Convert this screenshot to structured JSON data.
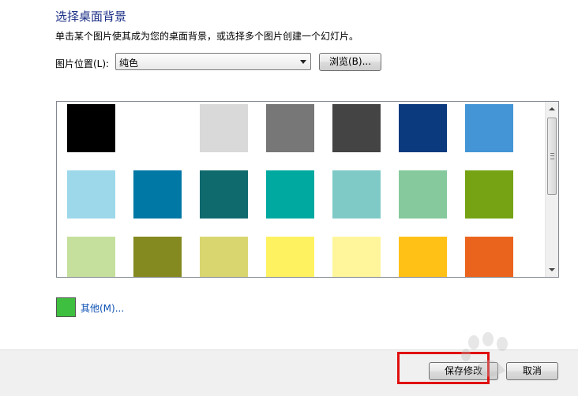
{
  "header": {
    "title": "选择桌面背景",
    "description": "单击某个图片使其成为您的桌面背景，或选择多个图片创建一个幻灯片。"
  },
  "location": {
    "label": "图片位置(L):",
    "selected": "纯色",
    "browse_label": "浏览(B)..."
  },
  "colors": {
    "rows": [
      [
        "#000000",
        "#ffffff",
        "#d9d9d9",
        "#777777",
        "#444444",
        "#0b3a7e",
        "#4395d6"
      ],
      [
        "#9cd8ea",
        "#0078a5",
        "#0f6a6e",
        "#00a9a0",
        "#7fcac7",
        "#85c99c",
        "#75a314"
      ],
      [
        "#c5e09d",
        "#848920",
        "#d9d670",
        "#fff261",
        "#fff69b",
        "#ffc116",
        "#eb641e"
      ]
    ]
  },
  "other": {
    "label": "其他(M)...",
    "color": "#3fbf3f"
  },
  "footer": {
    "save_label": "保存修改",
    "cancel_label": "取消"
  },
  "highlight_color": "#e01010"
}
